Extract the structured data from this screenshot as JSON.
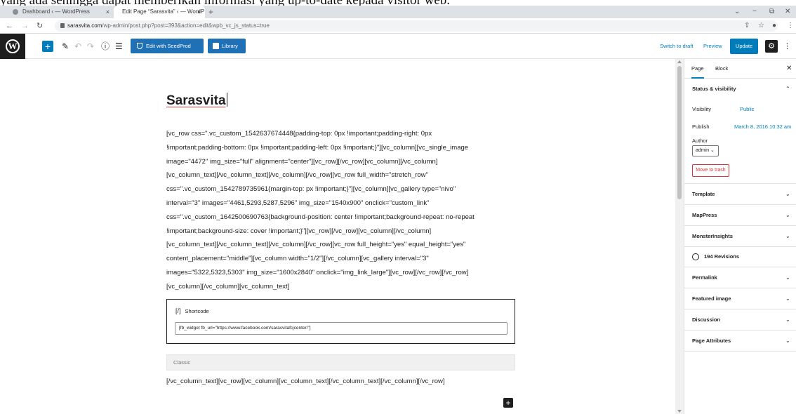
{
  "caption": "yang ada sehingga dapat memberikan informasi yang up-to-date kepada visitor web.",
  "browser": {
    "tabs": [
      {
        "label": "Dashboard ‹ — WordPress"
      },
      {
        "label": "Edit Page “Sarasvita” ‹ — WordP"
      }
    ],
    "new_tab": "+",
    "close": "×",
    "url_host": "sarasvita.com",
    "url_path": "/wp-admin/post.php?post=393&action=edit&wpb_vc_js_status=true"
  },
  "toolbar": {
    "seedprod_label": "Edit with SeedProd",
    "library_label": "Library",
    "switch_draft": "Switch to draft",
    "preview": "Preview",
    "update": "Update"
  },
  "editor": {
    "title": "Sarasvita",
    "code_lines": [
      "[vc_row css=\".vc_custom_1542637674448{padding-top: 0px !important;padding-right: 0px",
      "!important;padding-bottom: 0px !important;padding-left: 0px !important;}\"][vc_column][vc_single_image",
      "image=\"4472\" img_size=\"full\" alignment=\"center\"][vc_row][/vc_row][vc_column][/vc_column]",
      "[vc_column_text][/vc_column_text][/vc_column][/vc_row][vc_row full_width=\"stretch_row\"",
      "css=\".vc_custom_1542789735961{margin-top: px !important;}\"][vc_column][vc_gallery type=\"nivo\"",
      "interval=\"3\" images=\"4461,5293,5287,5296\" img_size=\"1540x900\" onclick=\"custom_link\"",
      "css=\".vc_custom_1642500690763{background-position: center !important;background-repeat: no-repeat",
      "!important;background-size: cover !important;}\"][vc_row][/vc_row][vc_column][/vc_column]",
      "[vc_column_text][/vc_column_text][/vc_column][/vc_row][vc_row full_height=\"yes\" equal_height=\"yes\"",
      "content_placement=\"middle\"][vc_column width=\"1/2\"][/vc_column][vc_gallery interval=\"3\"",
      "images=\"5322,5323,5303\" img_size=\"1600x2840\" onclick=\"img_link_large\"][vc_row][/vc_row][/vc_row]",
      "[vc_column][/vc_column][vc_column_text]"
    ],
    "shortcode_label": "Shortcode",
    "shortcode_icon": "[/]",
    "shortcode_value": "[fb_widget fb_url=\"https://www.facebook.com/sarasvitafcjcenter/\"]",
    "classic_label": "Classic",
    "footer_code": "[/vc_column_text][vc_row][vc_column][vc_column_text][/vc_column_text][/vc_column][/vc_row]"
  },
  "sidebar": {
    "tab_page": "Page",
    "tab_block": "Block",
    "status_title": "Status & visibility",
    "visibility_label": "Visibility",
    "visibility_value": "Public",
    "publish_label": "Publish",
    "publish_value": "March 8, 2016 10:32 am",
    "author_label": "Author",
    "author_value": "admin",
    "trash_label": "Move to trash",
    "panels_top": [
      "Template",
      "MapPress",
      "MonsterInsights"
    ],
    "revisions": "194 Revisions",
    "panels_bottom": [
      "Permalink",
      "Featured image",
      "Discussion",
      "Page Attributes"
    ]
  }
}
